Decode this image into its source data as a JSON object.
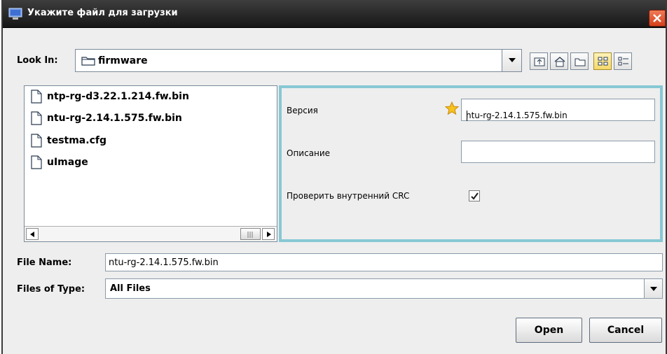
{
  "window": {
    "title": "Укажите файл для загрузки",
    "close_icon": "close-icon"
  },
  "lookin": {
    "label": "Look In:",
    "value": "firmware"
  },
  "toolbar": {
    "buttons": [
      "up-folder-icon",
      "home-icon",
      "new-folder-icon",
      "list-view-icon",
      "details-view-icon"
    ]
  },
  "files": [
    {
      "name": "ntp-rg-d3.22.1.214.fw.bin"
    },
    {
      "name": "ntu-rg-2.14.1.575.fw.bin"
    },
    {
      "name": "testma.cfg"
    },
    {
      "name": "uImage"
    }
  ],
  "accessory": {
    "version_label": "Версия",
    "version_value": "ntu-rg-2.14.1.575.fw.bin",
    "description_label": "Описание",
    "description_value": "",
    "crc_label": "Проверить внутренний CRC",
    "crc_checked": true
  },
  "filename": {
    "label": "File Name:",
    "value": "ntu-rg-2.14.1.575.fw.bin"
  },
  "filetype": {
    "label": "Files of Type:",
    "value": "All Files"
  },
  "buttons": {
    "open": "Open",
    "cancel": "Cancel"
  },
  "colors": {
    "accessory_border": "#87c8d4",
    "titlebar": "#1f1f1f",
    "close": "#e2552f"
  }
}
